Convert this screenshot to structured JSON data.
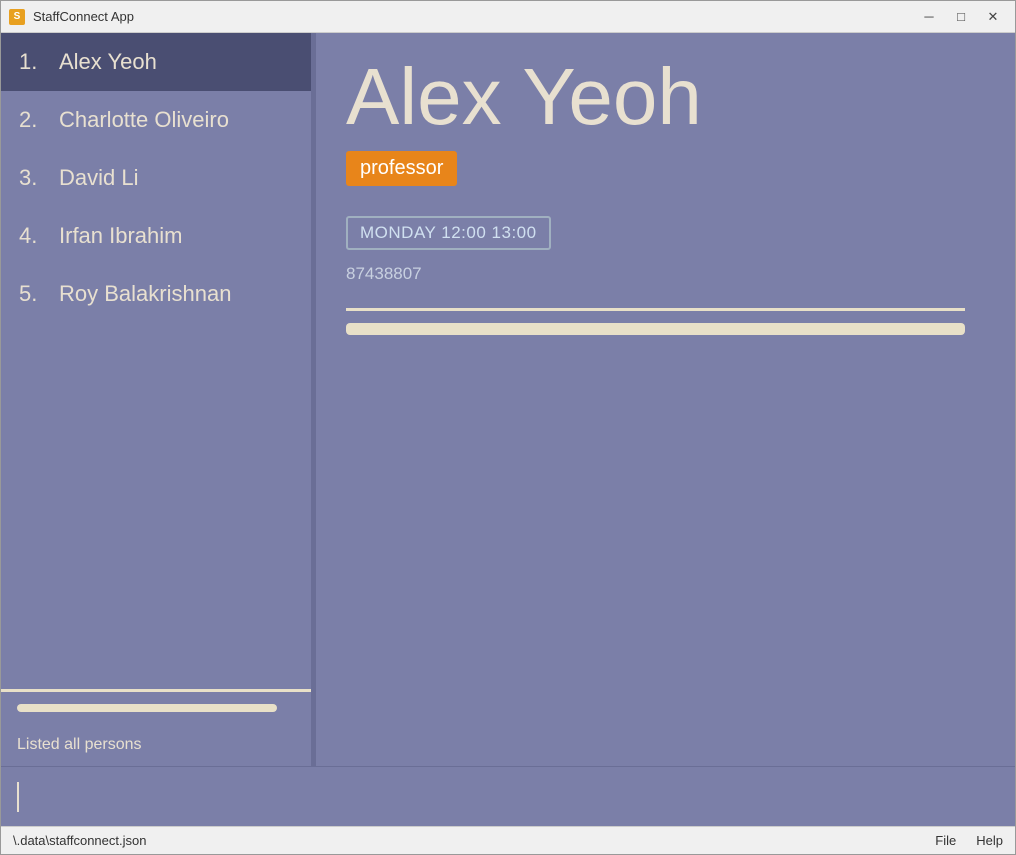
{
  "window": {
    "title": "StaffConnect App",
    "icon": "S"
  },
  "titlebar": {
    "minimize_label": "─",
    "maximize_label": "□",
    "close_label": "✕"
  },
  "sidebar": {
    "persons": [
      {
        "number": "1.",
        "name": "Alex Yeoh",
        "selected": true
      },
      {
        "number": "2.",
        "name": "Charlotte Oliveiro",
        "selected": false
      },
      {
        "number": "3.",
        "name": "David Li",
        "selected": false
      },
      {
        "number": "4.",
        "name": "Irfan Ibrahim",
        "selected": false
      },
      {
        "number": "5.",
        "name": "Roy Balakrishnan",
        "selected": false
      }
    ],
    "status": "Listed all persons"
  },
  "detail": {
    "name": "Alex Yeoh",
    "role": "professor",
    "schedule": "MONDAY 12:00 13:00",
    "phone": "87438807"
  },
  "statusbar": {
    "filepath": "\\.data\\staffconnect.json",
    "menu_file": "File",
    "menu_help": "Help"
  },
  "command": {
    "placeholder": ""
  }
}
